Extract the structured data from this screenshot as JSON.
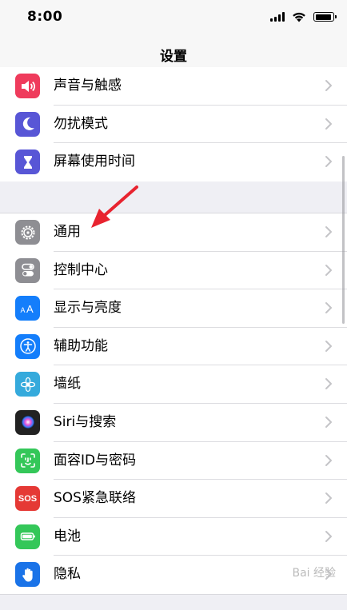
{
  "status_bar": {
    "time": "8:00"
  },
  "nav": {
    "title": "设置"
  },
  "group1": [
    {
      "label": "声音与触感",
      "icon": "speaker-icon",
      "color": "#ef3b5c"
    },
    {
      "label": "勿扰模式",
      "icon": "moon-icon",
      "color": "#5856d6"
    },
    {
      "label": "屏幕使用时间",
      "icon": "hourglass-icon",
      "color": "#5856d6"
    }
  ],
  "group2": [
    {
      "label": "通用",
      "icon": "gear-icon",
      "color": "#8e8e93"
    },
    {
      "label": "控制中心",
      "icon": "toggles-icon",
      "color": "#8e8e93"
    },
    {
      "label": "显示与亮度",
      "icon": "text-size-icon",
      "color": "#147efb"
    },
    {
      "label": "辅助功能",
      "icon": "accessibility-icon",
      "color": "#147efb"
    },
    {
      "label": "墙纸",
      "icon": "flower-icon",
      "color": "#35aadc"
    },
    {
      "label": "Siri与搜索",
      "icon": "siri-icon",
      "color": "#222222"
    },
    {
      "label": "面容ID与密码",
      "icon": "face-id-icon",
      "color": "#34c759"
    },
    {
      "label": "SOS紧急联络",
      "icon": "sos-icon",
      "color": "#e53935",
      "icon_text": "SOS"
    },
    {
      "label": "电池",
      "icon": "battery-icon",
      "color": "#34c759"
    },
    {
      "label": "隐私",
      "icon": "hand-icon",
      "color": "#1a73e8"
    }
  ],
  "watermark": "Bai 经验"
}
